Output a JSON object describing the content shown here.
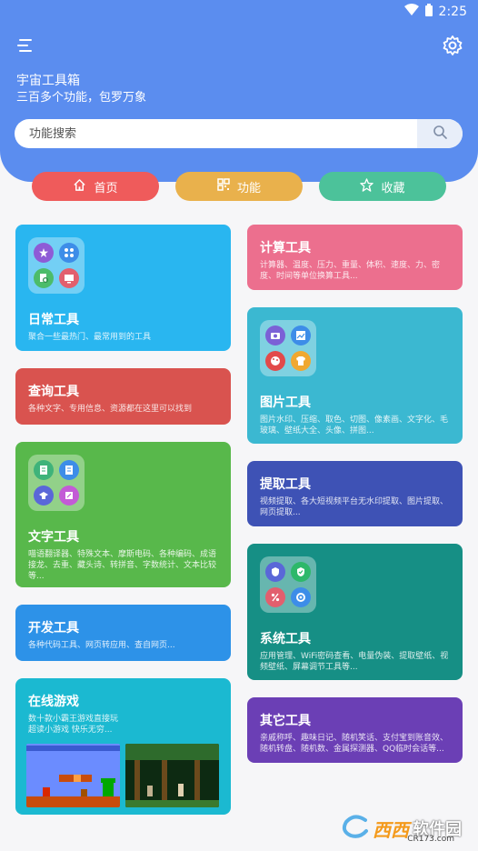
{
  "status": {
    "time": "2:25"
  },
  "header": {
    "title": "宇宙工具箱",
    "subtitle": "三百多个功能，包罗万象"
  },
  "search": {
    "placeholder": "功能搜索"
  },
  "tabs": [
    {
      "label": "首页",
      "color": "#ef5b5b"
    },
    {
      "label": "功能",
      "color": "#e9b14c"
    },
    {
      "label": "收藏",
      "color": "#4cc29a"
    }
  ],
  "cards": {
    "daily": {
      "title": "日常工具",
      "desc": "聚合一些最热门、最常用到的工具",
      "color": "#29b6f0"
    },
    "query": {
      "title": "查询工具",
      "desc": "各种文字、专用信息、资源都在这里可以找到",
      "color": "#d9534f"
    },
    "text": {
      "title": "文字工具",
      "desc": "喵语翻译器、特殊文本、摩斯电码、各种编码、成语接龙、去重、藏头诗、转拼音、字数统计、文本比较等...",
      "color": "#58b84b"
    },
    "dev": {
      "title": "开发工具",
      "desc": "各种代码工具、网页转应用、查自网页...",
      "color": "#2d92e8"
    },
    "games": {
      "title": "在线游戏",
      "desc": "数十款小霸王游戏直接玩\n超读小游戏 快乐无穷...",
      "color": "#1bb9d1"
    },
    "calc": {
      "title": "计算工具",
      "desc": "计算器、温度、压力、重量、体积、速度、力、密度、时间等单位换算工具...",
      "color": "#ec6f8e"
    },
    "image": {
      "title": "图片工具",
      "desc": "图片水印、压缩、取色、切图、像素画、文字化、毛玻璃、壁纸大全、头像、拼图...",
      "color": "#3bb8d1"
    },
    "extract": {
      "title": "提取工具",
      "desc": "视频提取、各大短视频平台无水印提取、图片提取、网页提取...",
      "color": "#3e52b5"
    },
    "system": {
      "title": "系统工具",
      "desc": "应用管理、WiFi密码查看、电量伪装、提取壁纸、视频壁纸、屏幕调节工具等...",
      "color": "#168f85"
    },
    "other": {
      "title": "其它工具",
      "desc": "亲戚称呼、趣味日记、随机笑话、支付宝到账音效、随机转盘、随机数、金属探测器、QQ临时会话等...",
      "color": "#6b3fb5"
    }
  },
  "watermark": {
    "logo": "西西",
    "name": "软件园",
    "url": "CR173.com"
  }
}
